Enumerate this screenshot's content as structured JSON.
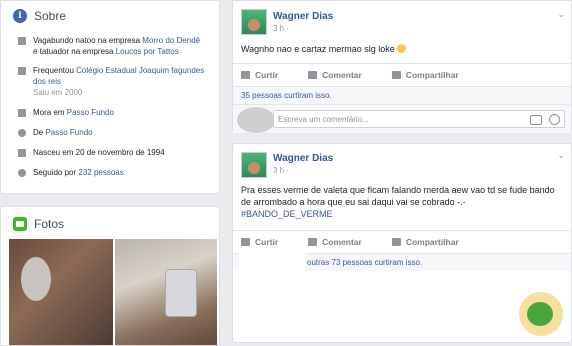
{
  "sobre": {
    "title": "Sobre",
    "rows": [
      {
        "icon": "briefcase-icon",
        "lines": [
          {
            "a": "Vagabundo natoo na empresa ",
            "b": "Morro do Dendê"
          },
          {
            "a": "e tatuador na empresa ",
            "b": "Loucos por Tattos"
          }
        ]
      },
      {
        "icon": "graduation-cap-icon",
        "a": "Frequentou ",
        "b": "Colégio Estadual Joaquim fagundes dos reis",
        "c": "Saiu em 2000"
      },
      {
        "icon": "home-icon",
        "a": "Mora em ",
        "b": "Passo Fundo"
      },
      {
        "icon": "map-pin-icon",
        "a": "De ",
        "b": "Passo Fundo"
      },
      {
        "icon": "birthday-cake-icon",
        "a": "Nasceu em 20 de novembro de 1994"
      },
      {
        "icon": "rss-icon",
        "a": "Seguido por ",
        "b": "232 pessoas"
      }
    ]
  },
  "fotos": {
    "title": "Fotos"
  },
  "posts": [
    {
      "author": "Wagner Dias",
      "time": "3 h ·",
      "text": "Wagnho nao e cartaz mermao slg loke",
      "actions": {
        "like": "Curtir",
        "comment": "Comentar",
        "share": "Compartilhar"
      },
      "likes_text": "35 pessoas curtiram isso.",
      "comment_placeholder": "Escreva um comentário..."
    },
    {
      "author": "Wagner Dias",
      "time": "3 h ·",
      "text": "Pra esses verme de valeta que ficam falando merda aew vao td se fude bando de arrombado a hora que eu sai daqui vai se cobrado -.-",
      "hashtag": "#BANDO_DE_VERME",
      "actions": {
        "like": "Curtir",
        "comment": "Comentar",
        "share": "Compartilhar"
      },
      "likes_text": "outras 73 pessoas curtiram isso."
    }
  ],
  "colors": {
    "link": "#365899",
    "brand": "#4267b2",
    "muted": "#90949c"
  }
}
